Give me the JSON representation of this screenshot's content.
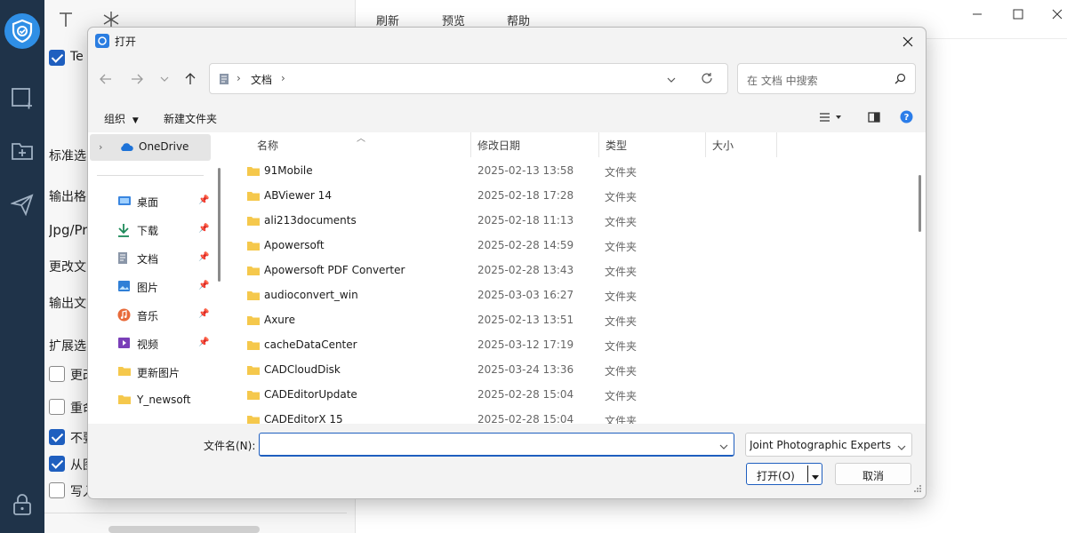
{
  "app": {
    "menu": [
      "刷新",
      "预览",
      "帮助"
    ],
    "panel": {
      "checkbox_top_label": "Te",
      "texts": [
        "标准选",
        "输出格",
        "Jpg/Pr",
        "更改文",
        "输出文",
        "扩展选"
      ],
      "options": [
        {
          "label": "更改",
          "checked": false
        },
        {
          "label": "重命",
          "checked": false
        },
        {
          "label": "不要",
          "checked": true
        },
        {
          "label": "从图",
          "checked": true
        },
        {
          "label": "写入",
          "checked": false
        }
      ]
    }
  },
  "dialog": {
    "title": "打开",
    "address": {
      "crumb": "文档",
      "sep": "›"
    },
    "search_placeholder": "在 文档 中搜索",
    "commands": {
      "organize": "组织",
      "new_folder": "新建文件夹"
    },
    "nav": {
      "onedrive": "OneDrive",
      "items": [
        {
          "label": "桌面",
          "icon": "desktop-icon",
          "pinned": true
        },
        {
          "label": "下载",
          "icon": "download-icon",
          "pinned": true
        },
        {
          "label": "文档",
          "icon": "document-icon",
          "pinned": true
        },
        {
          "label": "图片",
          "icon": "picture-icon",
          "pinned": true
        },
        {
          "label": "音乐",
          "icon": "music-icon",
          "pinned": true
        },
        {
          "label": "视频",
          "icon": "video-icon",
          "pinned": true
        },
        {
          "label": "更新图片",
          "icon": "folder-icon",
          "pinned": false
        },
        {
          "label": "Y_newsoft",
          "icon": "folder-icon",
          "pinned": false
        }
      ]
    },
    "columns": {
      "name": "名称",
      "date": "修改日期",
      "type": "类型",
      "size": "大小"
    },
    "files": [
      {
        "name": "91Mobile",
        "date": "2025-02-13 13:58",
        "type": "文件夹"
      },
      {
        "name": "ABViewer 14",
        "date": "2025-02-18 17:28",
        "type": "文件夹"
      },
      {
        "name": "ali213documents",
        "date": "2025-02-18 11:13",
        "type": "文件夹"
      },
      {
        "name": "Apowersoft",
        "date": "2025-02-28 14:59",
        "type": "文件夹"
      },
      {
        "name": "Apowersoft PDF Converter",
        "date": "2025-02-28 13:43",
        "type": "文件夹"
      },
      {
        "name": "audioconvert_win",
        "date": "2025-03-03 16:27",
        "type": "文件夹"
      },
      {
        "name": "Axure",
        "date": "2025-02-13 13:51",
        "type": "文件夹"
      },
      {
        "name": "cacheDataCenter",
        "date": "2025-03-12 17:19",
        "type": "文件夹"
      },
      {
        "name": "CADCloudDisk",
        "date": "2025-03-24 13:36",
        "type": "文件夹"
      },
      {
        "name": "CADEditorUpdate",
        "date": "2025-02-28 15:04",
        "type": "文件夹"
      },
      {
        "name": "CADEditorX 15",
        "date": "2025-02-28 15:04",
        "type": "文件夹"
      }
    ],
    "filename_label": "文件名(N):",
    "filename_value": "",
    "filter_value": "Joint Photographic Experts Group",
    "open_label": "打开(O)",
    "cancel_label": "取消"
  },
  "colors": {
    "accent": "#1f5fbf",
    "rail": "#1f3349",
    "folder": "#f5c84c",
    "logo": "#2f8fe6"
  }
}
